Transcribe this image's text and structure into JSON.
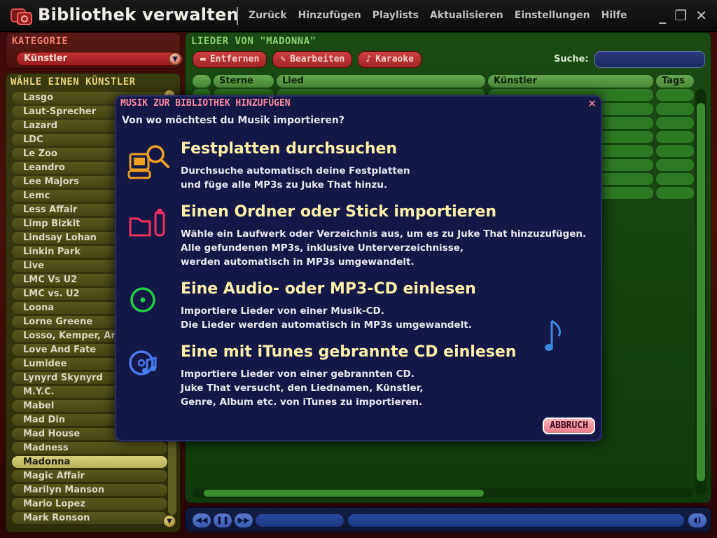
{
  "app": {
    "title": "Bibliothek verwalten",
    "menu": [
      "Zurück",
      "Hinzufügen",
      "Playlists",
      "Aktualisieren",
      "Einstellungen",
      "Hilfe"
    ],
    "window_controls": {
      "minimize": "_",
      "restore": "❐",
      "close": "✕"
    }
  },
  "category": {
    "heading": "KATEGORIE",
    "selected": "Künstler"
  },
  "artists": {
    "heading": "WÄHLE EINEN KÜNSTLER",
    "items": [
      "Lasgo",
      "Laut-Sprecher",
      "Lazard",
      "LDC",
      "Le Zoo",
      "Leandro",
      "Lee Majors",
      "Lemc",
      "Less Affair",
      "Limp Bizkit",
      "Lindsay Lohan",
      "Linkin Park",
      "Live",
      "LMC Vs U2",
      "LMC vs. U2",
      "Loona",
      "Lorne Greene",
      "Losso, Kemper, Ar",
      "Love And Fate",
      "Lumidee",
      "Lynyrd Skynyrd",
      "M.Y.C.",
      "Mabel",
      "Mad Din",
      "Mad House",
      "Madness",
      "Madonna",
      "Magic Affair",
      "Marilyn Manson",
      "Mario Lopez",
      "Mark Ronson"
    ],
    "selected": "Madonna"
  },
  "songs": {
    "heading": "LIEDER VON \"MADONNA\"",
    "toolbar": {
      "remove": "Entfernen",
      "edit": "Bearbeiten",
      "karaoke": "Karaoke"
    },
    "search_label": "Suche:",
    "search_value": "",
    "columns": {
      "stars": "Sterne",
      "song": "Lied",
      "artist": "Künstler",
      "tags": "Tags"
    }
  },
  "modal": {
    "title": "MUSIK ZUR BIBLIOTHEK HINZUFÜGEN",
    "question": "Von wo möchtest du Musik importieren?",
    "options": [
      {
        "icon": "computer-search-icon",
        "title": "Festplatten durchsuchen",
        "desc_1": "Durchsuche automatisch deine Festplatten",
        "desc_2": "und füge alle MP3s zu Juke That hinzu.",
        "desc_3": ""
      },
      {
        "icon": "folder-usb-icon",
        "title": "Einen Ordner oder Stick importieren",
        "desc_1": "Wähle ein Laufwerk oder Verzeichnis aus, um es zu Juke That hinzuzufügen.",
        "desc_2": "Alle gefundenen MP3s, inklusive Unterverzeichnisse,",
        "desc_3": "werden automatisch in MP3s umgewandelt."
      },
      {
        "icon": "cd-icon",
        "title": "Eine Audio- oder MP3-CD einlesen",
        "desc_1": "Importiere Lieder von einer Musik-CD.",
        "desc_2": "Die Lieder werden automatisch in MP3s umgewandelt.",
        "desc_3": ""
      },
      {
        "icon": "itunes-cd-icon",
        "title": "Eine mit iTunes gebrannte CD einlesen",
        "desc_1": "Importiere Lieder von einer gebrannten CD.",
        "desc_2": "Juke That versucht, den Liednamen, Künstler,",
        "desc_3": "Genre, Album etc. von iTunes zu importieren."
      }
    ],
    "cancel": "ABBRUCH"
  },
  "colors": {
    "modal_bg": "#131846",
    "option_title": "#fff0a8",
    "accent_pink": "#ff8aa0"
  }
}
